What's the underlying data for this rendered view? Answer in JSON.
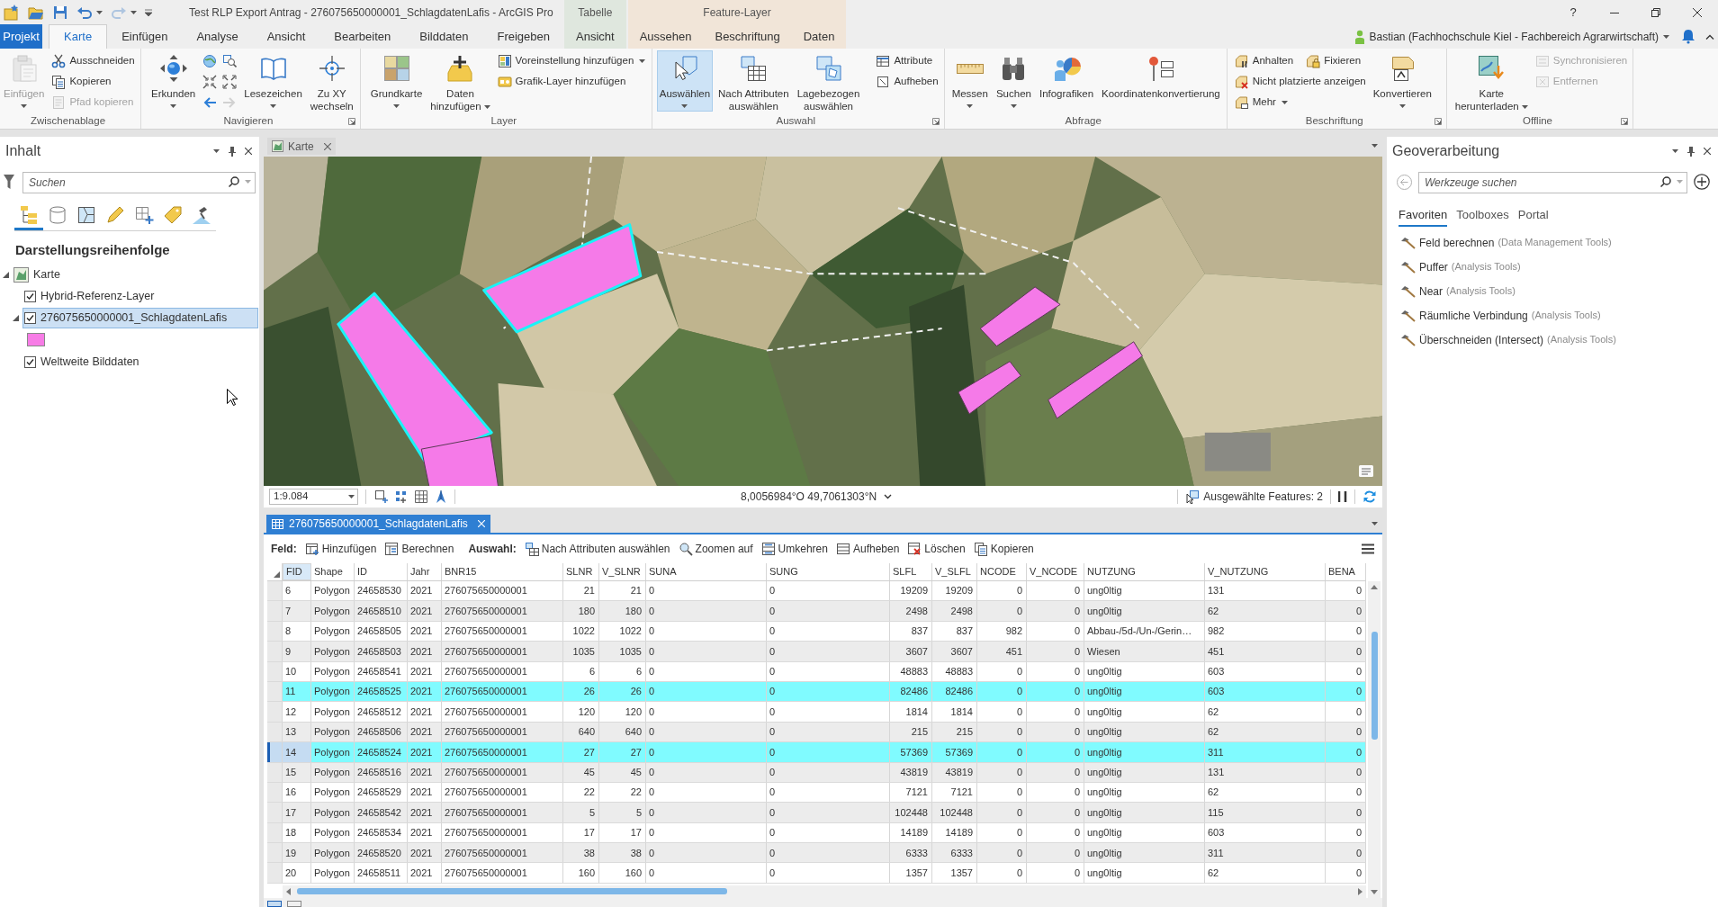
{
  "window": {
    "title": "Test RLP Export Antrag - 276075650000001_SchlagdatenLafis - ArcGIS Pro",
    "help": "?",
    "quick_access": [
      {
        "disabled": false
      },
      {
        "disabled": false
      },
      {
        "disabled": false
      },
      {
        "disabled": false
      },
      {
        "disabled": true
      }
    ],
    "context_groups": [
      {
        "label": "Tabelle",
        "kind": "table"
      },
      {
        "label": "Feature-Layer",
        "kind": "layer"
      }
    ]
  },
  "user": {
    "name": "Bastian (Fachhochschule Kiel - Fachbereich Agrarwirtschaft)"
  },
  "ribbon": {
    "tabs": [
      {
        "label": "Projekt",
        "kind": "file",
        "selected": false
      },
      {
        "label": "Karte",
        "kind": "core",
        "selected": true
      },
      {
        "label": "Einfügen",
        "kind": "core",
        "selected": false
      },
      {
        "label": "Analyse",
        "kind": "core",
        "selected": false
      },
      {
        "label": "Ansicht",
        "kind": "core",
        "selected": false
      },
      {
        "label": "Bearbeiten",
        "kind": "core",
        "selected": false
      },
      {
        "label": "Bilddaten",
        "kind": "core",
        "selected": false
      },
      {
        "label": "Freigeben",
        "kind": "core",
        "selected": false
      },
      {
        "label": "Ansicht",
        "kind": "table",
        "selected": false
      },
      {
        "label": "Aussehen",
        "kind": "layer",
        "selected": false
      },
      {
        "label": "Beschriftung",
        "kind": "layer",
        "selected": false
      },
      {
        "label": "Daten",
        "kind": "layer",
        "selected": false
      }
    ],
    "groups": [
      {
        "label": "Zwischenablage",
        "launcher": false,
        "items": [
          {
            "kind": "large",
            "lines": [
              "Einfügen"
            ],
            "disabled": true,
            "active": false,
            "dropdown": true
          },
          {
            "kind": "stack",
            "rows": [
              [
                {
                  "label": "Ausschneiden",
                  "disabled": false,
                  "dropdown": false
                }
              ],
              [
                {
                  "label": "Kopieren",
                  "disabled": false,
                  "dropdown": false
                }
              ],
              [
                {
                  "label": "Pfad kopieren",
                  "disabled": true,
                  "dropdown": false
                }
              ]
            ]
          }
        ]
      },
      {
        "label": "Navigieren",
        "launcher": true,
        "items": [
          {
            "kind": "large",
            "lines": [
              "Erkunden"
            ],
            "disabled": false,
            "active": false,
            "dropdown": true
          },
          {
            "kind": "grid",
            "buttons": [
              {
                "disabled": false
              },
              {
                "disabled": false
              },
              {
                "disabled": false
              },
              {
                "disabled": false
              },
              {
                "disabled": false
              },
              {
                "disabled": true
              }
            ]
          },
          {
            "kind": "large",
            "lines": [
              "Lesezeichen"
            ],
            "disabled": false,
            "active": false,
            "dropdown": true
          },
          {
            "kind": "large",
            "lines": [
              "Zu XY",
              "wechseln"
            ],
            "disabled": false,
            "active": false,
            "dropdown": false
          }
        ]
      },
      {
        "label": "Layer",
        "launcher": false,
        "items": [
          {
            "kind": "large",
            "lines": [
              "Grundkarte"
            ],
            "disabled": false,
            "active": false,
            "dropdown": true
          },
          {
            "kind": "large",
            "lines": [
              "Daten",
              "hinzufügen"
            ],
            "disabled": false,
            "active": false,
            "dropdown": true
          },
          {
            "kind": "stack",
            "rows": [
              [
                {
                  "label": "Voreinstellung hinzufügen",
                  "disabled": false,
                  "dropdown": true
                }
              ],
              [
                {
                  "label": "Grafik-Layer hinzufügen",
                  "disabled": false,
                  "dropdown": false
                }
              ]
            ]
          }
        ]
      },
      {
        "label": "Auswahl",
        "launcher": true,
        "items": [
          {
            "kind": "large",
            "lines": [
              "Auswählen"
            ],
            "disabled": false,
            "active": true,
            "dropdown": true
          },
          {
            "kind": "large",
            "lines": [
              "Nach Attributen",
              "auswählen"
            ],
            "disabled": false,
            "active": false,
            "dropdown": false
          },
          {
            "kind": "large",
            "lines": [
              "Lagebezogen",
              "auswählen"
            ],
            "disabled": false,
            "active": false,
            "dropdown": false
          },
          {
            "kind": "stack",
            "rows": [
              [
                {
                  "label": "Attribute",
                  "disabled": false,
                  "dropdown": false
                }
              ],
              [
                {
                  "label": "Aufheben",
                  "disabled": false,
                  "dropdown": false
                }
              ]
            ]
          }
        ]
      },
      {
        "label": "Abfrage",
        "launcher": false,
        "items": [
          {
            "kind": "large",
            "lines": [
              "Messen"
            ],
            "disabled": false,
            "active": false,
            "dropdown": true
          },
          {
            "kind": "large",
            "lines": [
              "Suchen"
            ],
            "disabled": false,
            "active": false,
            "dropdown": true
          },
          {
            "kind": "large",
            "lines": [
              "Infografiken"
            ],
            "disabled": false,
            "active": false,
            "dropdown": false
          },
          {
            "kind": "large",
            "lines": [
              "Koordinatenkonvertierung"
            ],
            "disabled": false,
            "active": false,
            "dropdown": false
          }
        ]
      },
      {
        "label": "Beschriftung",
        "launcher": true,
        "items": [
          {
            "kind": "stack",
            "rows": [
              [
                {
                  "label": "Anhalten",
                  "disabled": false,
                  "dropdown": false
                },
                {
                  "label": "Fixieren",
                  "disabled": false,
                  "dropdown": false
                }
              ],
              [
                {
                  "label": "Nicht platzierte anzeigen",
                  "disabled": false,
                  "dropdown": false
                }
              ],
              [
                {
                  "label": "Mehr",
                  "disabled": false,
                  "dropdown": true
                }
              ]
            ]
          },
          {
            "kind": "large",
            "lines": [
              "Konvertieren"
            ],
            "disabled": false,
            "active": false,
            "dropdown": true
          }
        ]
      },
      {
        "label": "Offline",
        "launcher": true,
        "items": [
          {
            "kind": "large",
            "lines": [
              "Karte",
              "herunterladen"
            ],
            "disabled": false,
            "active": false,
            "dropdown": true
          },
          {
            "kind": "stack",
            "rows": [
              [
                {
                  "label": "Synchronisieren",
                  "disabled": true,
                  "dropdown": false
                }
              ],
              [
                {
                  "label": "Entfernen",
                  "disabled": true,
                  "dropdown": false
                }
              ]
            ]
          }
        ]
      }
    ]
  },
  "contents": {
    "title": "Inhalt",
    "search": {
      "placeholder": "Suchen"
    },
    "view_tabs": [
      {
        "selected": true
      },
      {
        "selected": false
      },
      {
        "selected": false
      },
      {
        "selected": false
      },
      {
        "selected": false
      },
      {
        "selected": false
      },
      {
        "selected": false
      }
    ],
    "heading": "Darstellungsreihenfolge",
    "tree": [
      {
        "label": "Karte",
        "expanded": true,
        "children": [
          {
            "label": "Hybrid-Referenz-Layer",
            "checked": true,
            "selected": false
          },
          {
            "label": "276075650000001_SchlagdatenLafis",
            "checked": true,
            "selected": true,
            "expanded": true,
            "color": "#f77ce6"
          },
          {
            "label": "Weltweite Bilddaten",
            "checked": true,
            "selected": false
          }
        ]
      }
    ]
  },
  "geoprocessing": {
    "title": "Geoverarbeitung",
    "search": {
      "placeholder": "Werkzeuge suchen"
    },
    "tabs": [
      {
        "label": "Favoriten",
        "selected": true
      },
      {
        "label": "Toolboxes",
        "selected": false
      },
      {
        "label": "Portal",
        "selected": false
      }
    ],
    "tools": [
      {
        "name": "Feld berechnen",
        "toolbox": "(Data Management Tools)"
      },
      {
        "name": "Puffer",
        "toolbox": "(Analysis Tools)"
      },
      {
        "name": "Near",
        "toolbox": "(Analysis Tools)"
      },
      {
        "name": "Räumliche Verbindung",
        "toolbox": "(Analysis Tools)"
      },
      {
        "name": "Überschneiden (Intersect)",
        "toolbox": "(Analysis Tools)"
      }
    ]
  },
  "map_view": {
    "tab": {
      "label": "Karte"
    },
    "parcels": [
      {
        "selected": true
      },
      {
        "selected": true
      },
      {
        "selected": false
      },
      {
        "selected": false
      },
      {
        "selected": false
      },
      {
        "selected": false
      }
    ],
    "status": {
      "scale": "1:9.084",
      "coordinates": "8,0056984°O 49,7061303°N",
      "selected_features": "Ausgewählte Features: 2"
    }
  },
  "attribute_table": {
    "tab": {
      "label": "276075650000001_SchlagdatenLafis"
    },
    "toolbar": [
      {
        "label": "Feld:",
        "buttons": [
          "Hinzufügen",
          "Berechnen"
        ]
      },
      {
        "label": "Auswahl:",
        "buttons": [
          "Nach Attributen auswählen",
          "Zoomen auf",
          "Umkehren",
          "Aufheben",
          "Löschen",
          "Kopieren"
        ]
      }
    ],
    "columns": [
      {
        "label": "FID",
        "kind": "text",
        "selected": true
      },
      {
        "label": "Shape",
        "kind": "text",
        "selected": false
      },
      {
        "label": "ID",
        "kind": "text",
        "selected": false
      },
      {
        "label": "Jahr",
        "kind": "text",
        "selected": false
      },
      {
        "label": "BNR15",
        "kind": "text",
        "selected": false
      },
      {
        "label": "SLNR",
        "kind": "number",
        "selected": false
      },
      {
        "label": "V_SLNR",
        "kind": "number",
        "selected": false
      },
      {
        "label": "SUNA",
        "kind": "text",
        "selected": false
      },
      {
        "label": "SUNG",
        "kind": "text",
        "selected": false
      },
      {
        "label": "SLFL",
        "kind": "number",
        "selected": false
      },
      {
        "label": "V_SLFL",
        "kind": "number",
        "selected": false
      },
      {
        "label": "NCODE",
        "kind": "number",
        "selected": false
      },
      {
        "label": "V_NCODE",
        "kind": "number",
        "selected": false
      },
      {
        "label": "NUTZUNG",
        "kind": "text",
        "selected": false
      },
      {
        "label": "V_NUTZUNG",
        "kind": "text",
        "selected": false
      },
      {
        "label": "BENA",
        "kind": "number",
        "selected": false
      }
    ],
    "rows": [
      {
        "cells": [
          "6",
          "Polygon",
          "24658530",
          "2021",
          "276075650000001",
          "21",
          "21",
          "0",
          "0",
          "19209",
          "19209",
          "0",
          "0",
          "ung0ltig",
          "131",
          "0"
        ],
        "selected": false,
        "current": false
      },
      {
        "cells": [
          "7",
          "Polygon",
          "24658510",
          "2021",
          "276075650000001",
          "180",
          "180",
          "0",
          "0",
          "2498",
          "2498",
          "0",
          "0",
          "ung0ltig",
          "62",
          "0"
        ],
        "selected": false,
        "current": false
      },
      {
        "cells": [
          "8",
          "Polygon",
          "24658505",
          "2021",
          "276075650000001",
          "1022",
          "1022",
          "0",
          "0",
          "837",
          "837",
          "982",
          "0",
          "Abbau-/5d-/Un-/Gerin…",
          "982",
          "0"
        ],
        "selected": false,
        "current": false
      },
      {
        "cells": [
          "9",
          "Polygon",
          "24658503",
          "2021",
          "276075650000001",
          "1035",
          "1035",
          "0",
          "0",
          "3607",
          "3607",
          "451",
          "0",
          "Wiesen",
          "451",
          "0"
        ],
        "selected": false,
        "current": false
      },
      {
        "cells": [
          "10",
          "Polygon",
          "24658541",
          "2021",
          "276075650000001",
          "6",
          "6",
          "0",
          "0",
          "48883",
          "48883",
          "0",
          "0",
          "ung0ltig",
          "603",
          "0"
        ],
        "selected": false,
        "current": false
      },
      {
        "cells": [
          "11",
          "Polygon",
          "24658525",
          "2021",
          "276075650000001",
          "26",
          "26",
          "0",
          "0",
          "82486",
          "82486",
          "0",
          "0",
          "ung0ltig",
          "603",
          "0"
        ],
        "selected": true,
        "current": false
      },
      {
        "cells": [
          "12",
          "Polygon",
          "24658512",
          "2021",
          "276075650000001",
          "120",
          "120",
          "0",
          "0",
          "1814",
          "1814",
          "0",
          "0",
          "ung0ltig",
          "62",
          "0"
        ],
        "selected": false,
        "current": false
      },
      {
        "cells": [
          "13",
          "Polygon",
          "24658506",
          "2021",
          "276075650000001",
          "640",
          "640",
          "0",
          "0",
          "215",
          "215",
          "0",
          "0",
          "ung0ltig",
          "62",
          "0"
        ],
        "selected": false,
        "current": false
      },
      {
        "cells": [
          "14",
          "Polygon",
          "24658524",
          "2021",
          "276075650000001",
          "27",
          "27",
          "0",
          "0",
          "57369",
          "57369",
          "0",
          "0",
          "ung0ltig",
          "311",
          "0"
        ],
        "selected": true,
        "current": true
      },
      {
        "cells": [
          "15",
          "Polygon",
          "24658516",
          "2021",
          "276075650000001",
          "45",
          "45",
          "0",
          "0",
          "43819",
          "43819",
          "0",
          "0",
          "ung0ltig",
          "131",
          "0"
        ],
        "selected": false,
        "current": false
      },
      {
        "cells": [
          "16",
          "Polygon",
          "24658529",
          "2021",
          "276075650000001",
          "22",
          "22",
          "0",
          "0",
          "7121",
          "7121",
          "0",
          "0",
          "ung0ltig",
          "62",
          "0"
        ],
        "selected": false,
        "current": false
      },
      {
        "cells": [
          "17",
          "Polygon",
          "24658542",
          "2021",
          "276075650000001",
          "5",
          "5",
          "0",
          "0",
          "102448",
          "102448",
          "0",
          "0",
          "ung0ltig",
          "115",
          "0"
        ],
        "selected": false,
        "current": false
      },
      {
        "cells": [
          "18",
          "Polygon",
          "24658534",
          "2021",
          "276075650000001",
          "17",
          "17",
          "0",
          "0",
          "14189",
          "14189",
          "0",
          "0",
          "ung0ltig",
          "603",
          "0"
        ],
        "selected": false,
        "current": false
      },
      {
        "cells": [
          "19",
          "Polygon",
          "24658520",
          "2021",
          "276075650000001",
          "38",
          "38",
          "0",
          "0",
          "6333",
          "6333",
          "0",
          "0",
          "ung0ltig",
          "311",
          "0"
        ],
        "selected": false,
        "current": false
      },
      {
        "cells": [
          "20",
          "Polygon",
          "24658511",
          "2021",
          "276075650000001",
          "160",
          "160",
          "0",
          "0",
          "1357",
          "1357",
          "0",
          "0",
          "ung0ltig",
          "62",
          "0"
        ],
        "selected": false,
        "current": false
      }
    ]
  }
}
